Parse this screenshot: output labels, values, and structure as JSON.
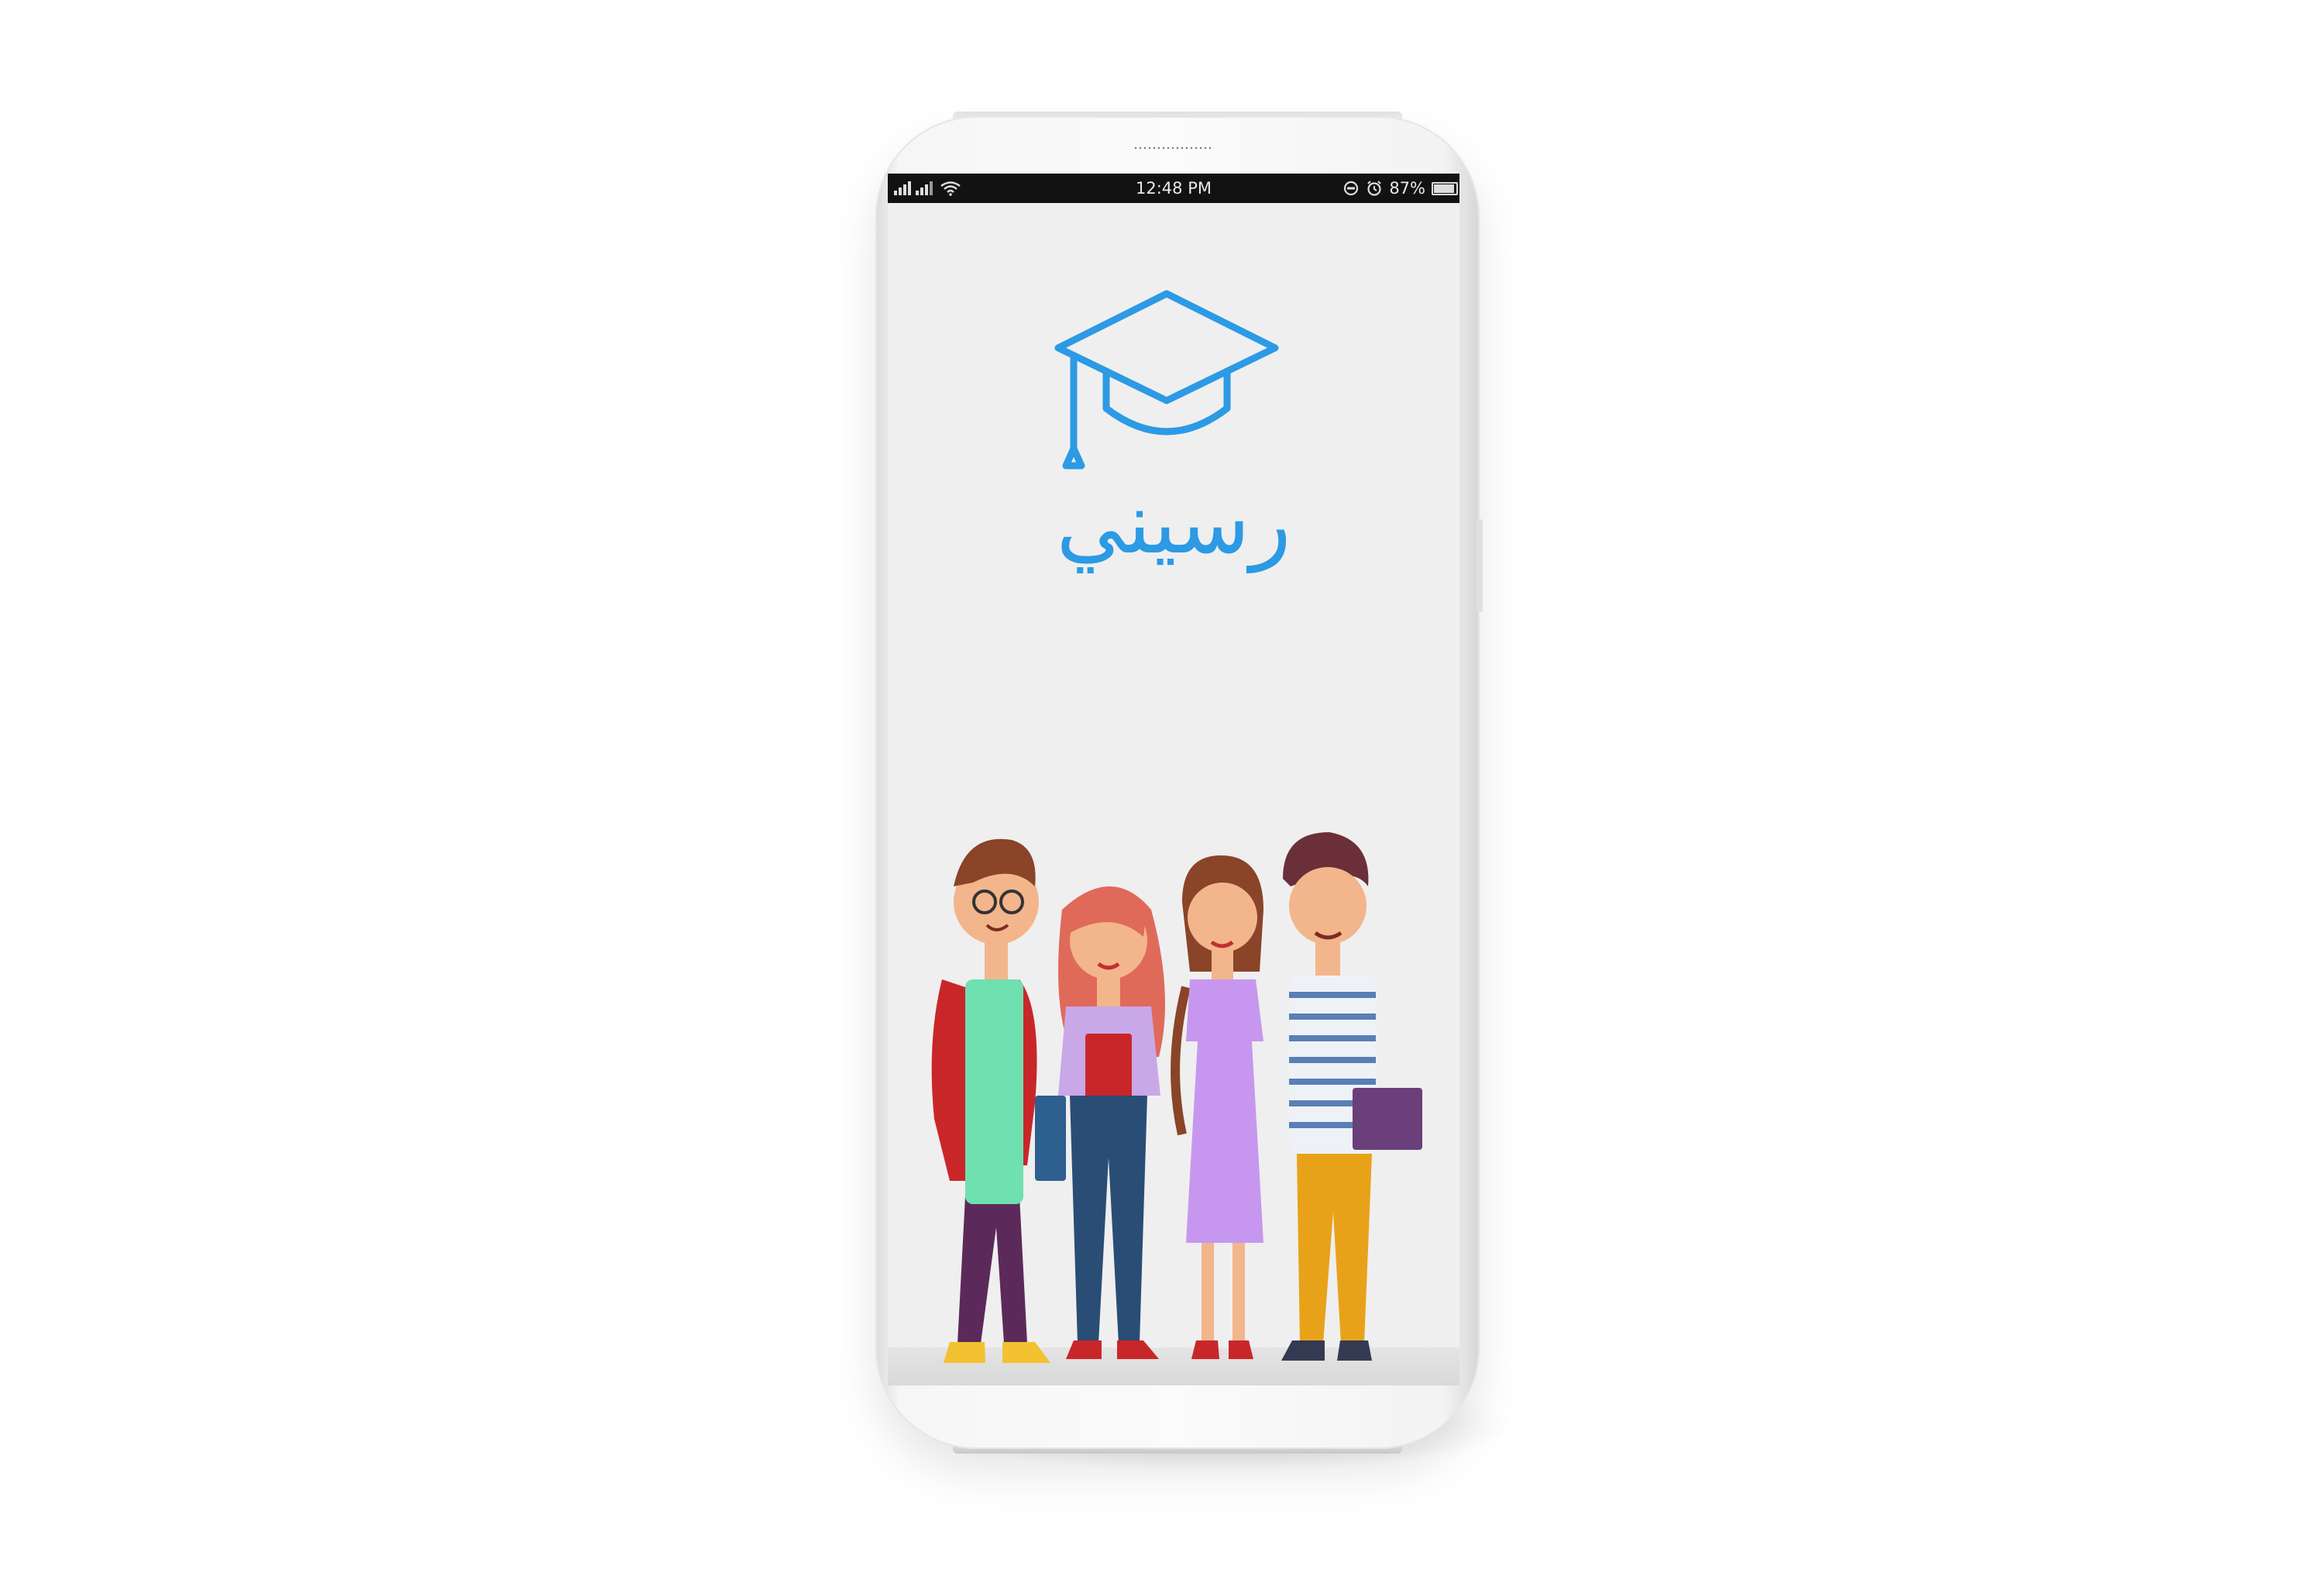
{
  "status_bar": {
    "signal_text": "",
    "time": "12:48 PM",
    "battery_percent": "87%",
    "battery_level": 0.87,
    "icons": [
      "signal-icon",
      "wifi-icon",
      "do-not-disturb-icon",
      "alarm-icon",
      "battery-icon"
    ]
  },
  "splash": {
    "logo_icon": "graduation-cap-icon",
    "app_name": "رسيني",
    "illustration": "students-group-illustration"
  },
  "colors": {
    "brand": "#2c9ae4",
    "screen_background": "#efefef",
    "status_bar": "#121212"
  }
}
